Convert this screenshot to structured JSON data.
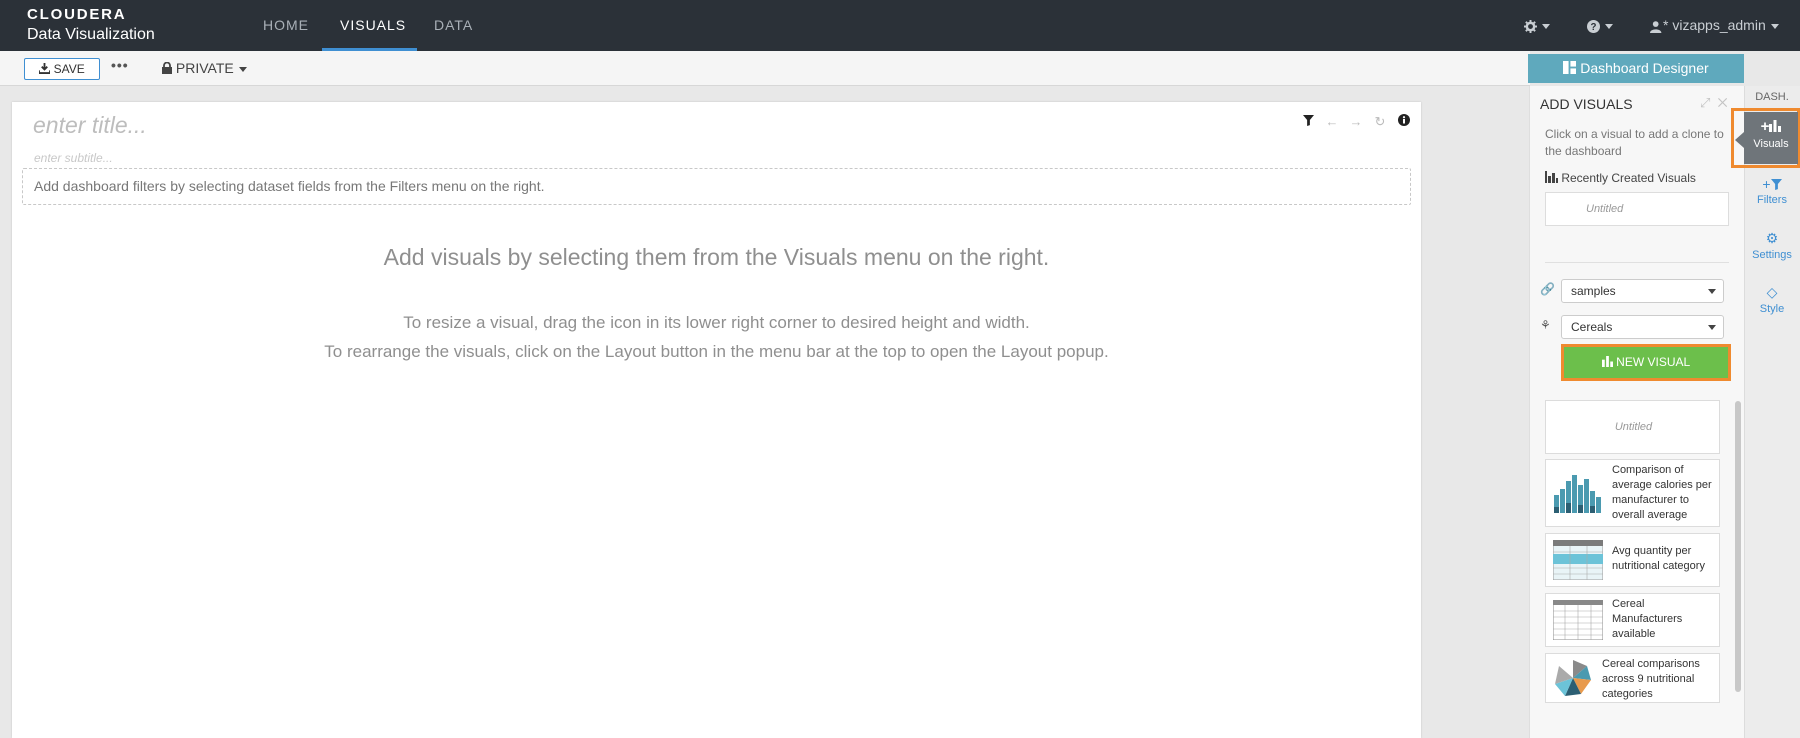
{
  "brand": {
    "line1": "CLOUDERA",
    "line2": "Data Visualization"
  },
  "nav": {
    "tabs": [
      "HOME",
      "VISUALS",
      "DATA"
    ],
    "active": "VISUALS",
    "user": "vizapps_admin"
  },
  "toolbar": {
    "save_label": "SAVE",
    "more_label": "•••",
    "privacy_label": "PRIVATE",
    "designer_label": "Dashboard Designer"
  },
  "canvas": {
    "title_placeholder": "enter title...",
    "subtitle_placeholder": "enter subtitle...",
    "filter_hint": "Add dashboard filters by selecting dataset fields from the Filters menu on the right.",
    "main_message": "Add visuals by selecting them from the Visuals menu on the right.",
    "resize_hint": "To resize a visual, drag the icon in its lower right corner to desired height and width.",
    "layout_hint": "To rearrange the visuals, click on the Layout button in the menu bar at the top to open the Layout popup."
  },
  "panel": {
    "title": "ADD VISUALS",
    "hint": "Click on a visual to add a clone to the dashboard",
    "recent_label": "Recently Created Visuals",
    "recent_item": "Untitled",
    "connection": "samples",
    "dataset": "Cereals",
    "new_visual_label": "NEW VISUAL",
    "visuals": [
      {
        "title": "Untitled"
      },
      {
        "title": "Comparison of average calories per manufacturer to overall average"
      },
      {
        "title": "Avg quantity per nutritional category"
      },
      {
        "title": "Cereal Manufacturers available"
      },
      {
        "title": "Cereal comparisons across 9 nutritional categories"
      }
    ]
  },
  "sidetabs": {
    "header": "DASH.",
    "visuals": "Visuals",
    "filters": "Filters",
    "settings": "Settings",
    "style": "Style"
  },
  "colors": {
    "nav_bg": "#2b3138",
    "accent_blue": "#3f8fd2",
    "designer_teal": "#5fa9bd",
    "new_visual_green": "#6cbf4b",
    "highlight_orange": "#ef8a2f"
  }
}
